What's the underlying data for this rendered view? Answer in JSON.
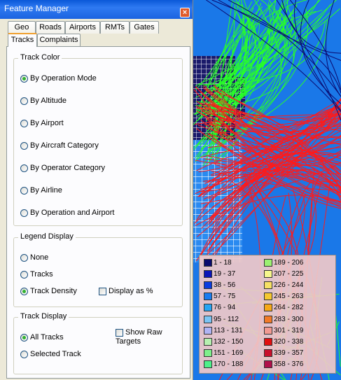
{
  "window": {
    "title": "Feature Manager",
    "close_glyph": "×"
  },
  "tabs_top": [
    "Geo",
    "Roads",
    "Airports",
    "RMTs",
    "Gates"
  ],
  "tabs_second": [
    "Tracks",
    "Complaints"
  ],
  "active_tab": "Tracks",
  "track_color": {
    "label": "Track Color",
    "options": [
      "By Operation Mode",
      "By Altitude",
      "By Airport",
      "By Aircraft Category",
      "By Operator Category",
      "By Airline",
      "By Operation and Airport"
    ],
    "selected": "By Operation Mode"
  },
  "legend_display": {
    "label": "Legend Display",
    "options": [
      "None",
      "Tracks",
      "Track Density"
    ],
    "selected": "Track Density",
    "display_as_percent": {
      "label": "Display as %",
      "checked": false
    }
  },
  "track_display": {
    "label": "Track Display",
    "options": [
      "All Tracks",
      "Selected Track"
    ],
    "selected": "All Tracks",
    "show_raw_targets": {
      "label": "Show Raw Targets",
      "checked": false
    }
  },
  "density_legend": {
    "left": [
      {
        "range": "1 - 18",
        "color": "#0a0a6e"
      },
      {
        "range": "19 - 37",
        "color": "#0b14b8"
      },
      {
        "range": "38 - 56",
        "color": "#0a3ce0"
      },
      {
        "range": "57 - 75",
        "color": "#1a7cf0"
      },
      {
        "range": "76 - 94",
        "color": "#27a4f4"
      },
      {
        "range": "95 - 112",
        "color": "#7cc4f4"
      },
      {
        "range": "113 - 131",
        "color": "#b0b4f4"
      },
      {
        "range": "132 - 150",
        "color": "#b6f0b0"
      },
      {
        "range": "151 - 169",
        "color": "#7ef08c"
      },
      {
        "range": "170 - 188",
        "color": "#4ef08a"
      }
    ],
    "right": [
      {
        "range": "189 - 206",
        "color": "#9cf072"
      },
      {
        "range": "207 - 225",
        "color": "#f6f68c"
      },
      {
        "range": "226 - 244",
        "color": "#f6e064"
      },
      {
        "range": "245 - 263",
        "color": "#f6c830"
      },
      {
        "range": "264 - 282",
        "color": "#f6a818"
      },
      {
        "range": "283 - 300",
        "color": "#f27a28"
      },
      {
        "range": "301 - 319",
        "color": "#f29a92"
      },
      {
        "range": "320 - 338",
        "color": "#e01010"
      },
      {
        "range": "339 - 357",
        "color": "#c8102c"
      },
      {
        "range": "358 - 376",
        "color": "#b0104a"
      }
    ]
  },
  "colors": {
    "map_background": "#1a78e8",
    "track_red": "#ff1a1a",
    "track_green": "#28ff28",
    "dialog_bg": "#ece9d8"
  }
}
